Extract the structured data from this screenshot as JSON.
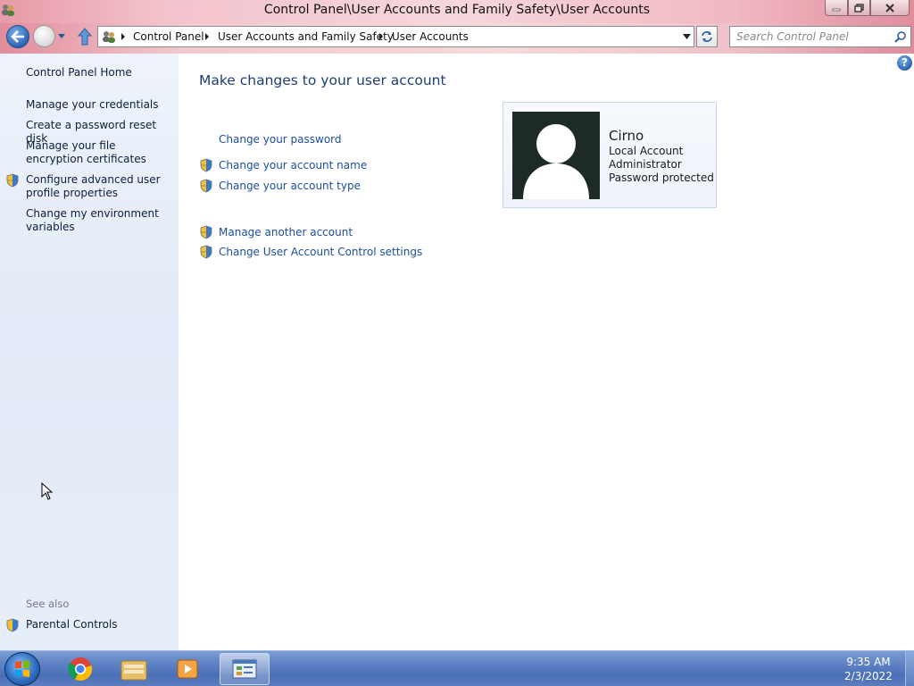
{
  "window": {
    "title": "Control Panel\\User Accounts and Family Safety\\User Accounts"
  },
  "navbar": {
    "breadcrumb": [
      "Control Panel",
      "User Accounts and Family Safety",
      "User Accounts"
    ],
    "search_placeholder": "Search Control Panel"
  },
  "left_pane": {
    "home": "Control Panel Home",
    "links": [
      "Manage your credentials",
      "Create a password reset disk",
      "Manage your file encryption certificates",
      "Configure advanced user profile properties",
      "Change my environment variables"
    ],
    "see_also_label": "See also",
    "see_also_links": [
      "Parental Controls"
    ]
  },
  "main": {
    "title": "Make changes to your user account",
    "tasks": [
      "Change your password",
      "Change your account name",
      "Change your account type"
    ],
    "other_tasks": [
      "Manage another account",
      "Change User Account Control settings"
    ],
    "help_label": "?"
  },
  "account": {
    "name": "Cirno",
    "type": "Local Account",
    "role": "Administrator",
    "status": "Password protected"
  },
  "taskbar": {
    "apps": [
      "start-orb",
      "chrome",
      "file-explorer",
      "media-player",
      "control-panel"
    ],
    "time": "9:35 AM",
    "date": "2/3/2022"
  },
  "colors": {
    "link": "#1b4f9c",
    "title": "#1e3d77",
    "taskbar": "#5f83c4",
    "titlebar_accent": "#f3c3cc"
  }
}
